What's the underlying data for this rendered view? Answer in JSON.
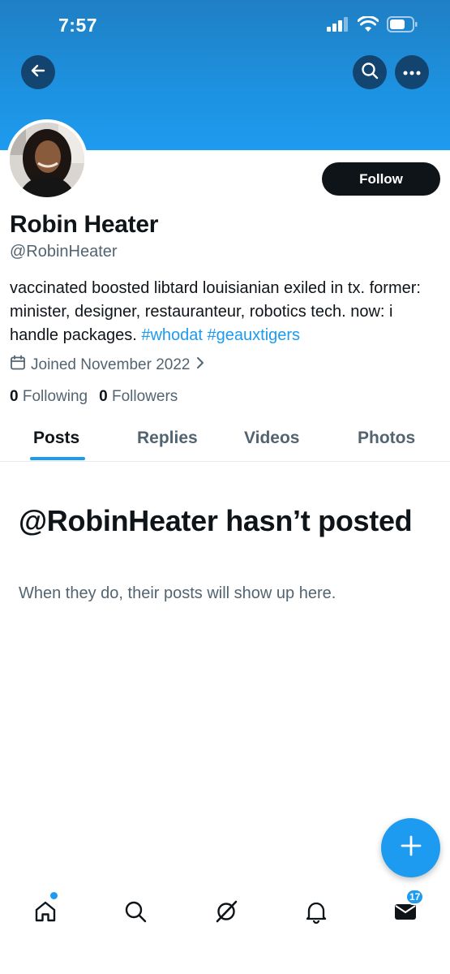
{
  "status_bar": {
    "time": "7:57"
  },
  "profile": {
    "display_name": "Robin Heater",
    "handle": "@RobinHeater",
    "follow_label": "Follow",
    "bio_text": "vaccinated boosted libtard louisianian exiled in tx. former: minister, designer, restauranteur, robotics tech. now: i handle packages. ",
    "bio_hashtags": [
      "#whodat",
      "#geauxtigers"
    ],
    "joined": "Joined November 2022",
    "following_count": "0",
    "following_label": "Following",
    "followers_count": "0",
    "followers_label": "Followers"
  },
  "tabs": [
    {
      "label": "Posts",
      "active": true
    },
    {
      "label": "Replies",
      "active": false
    },
    {
      "label": "Videos",
      "active": false
    },
    {
      "label": "Photos",
      "active": false
    }
  ],
  "empty_state": {
    "title": "@RobinHeater hasn’t posted",
    "subtitle": "When they do, their posts will show up here."
  },
  "bottom_nav": {
    "items": [
      "home-icon",
      "search-icon",
      "grok-icon",
      "notifications-icon",
      "messages-icon"
    ],
    "messages_badge": "17"
  },
  "colors": {
    "accent": "#1d9bf0",
    "text": "#0f1419",
    "muted": "#536471"
  }
}
